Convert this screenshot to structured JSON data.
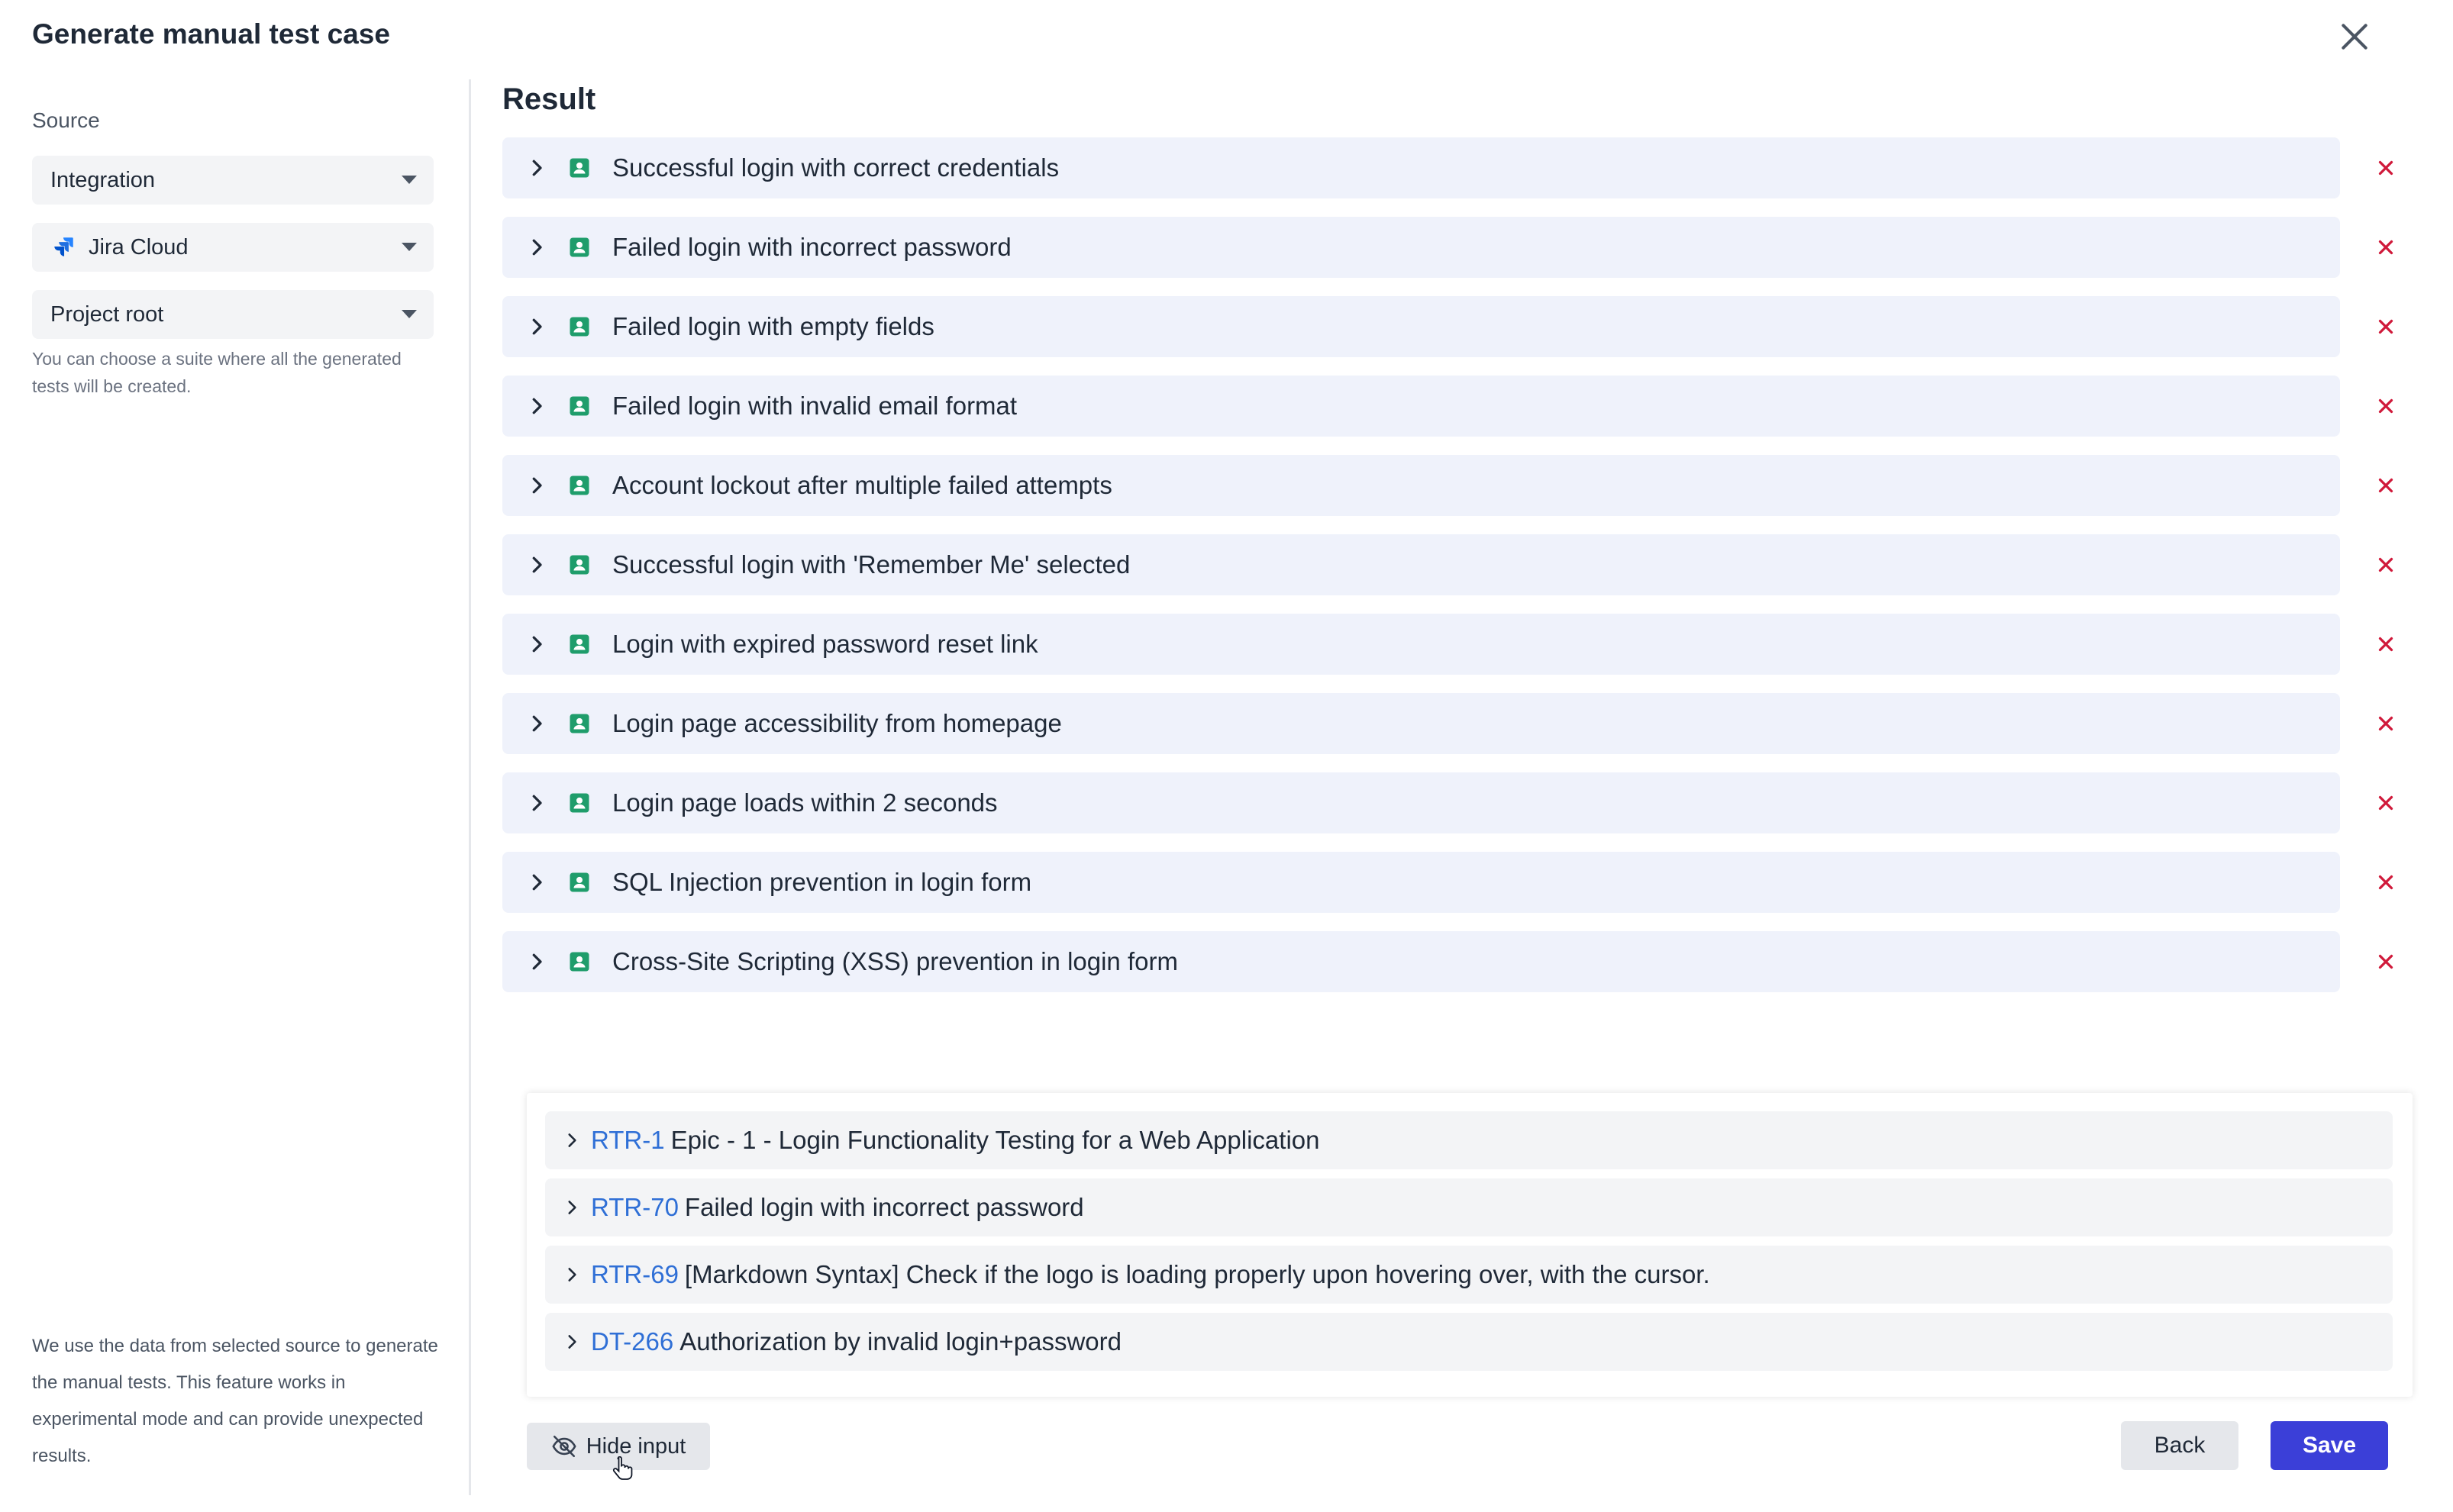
{
  "modal": {
    "title": "Generate manual test case"
  },
  "source": {
    "label": "Source",
    "type_select": "Integration",
    "integration_select": "Jira Cloud",
    "suite_select": "Project root",
    "help_text": "You can choose a suite where all the generated tests will be created.",
    "footer_note": "We use the data from selected source to generate the manual tests. This feature works in experimental mode and can provide unexpected results."
  },
  "result": {
    "title": "Result",
    "items": [
      {
        "label": "Successful login with correct credentials"
      },
      {
        "label": "Failed login with incorrect password"
      },
      {
        "label": "Failed login with empty fields"
      },
      {
        "label": "Failed login with invalid email format"
      },
      {
        "label": "Account lockout after multiple failed attempts"
      },
      {
        "label": "Successful login with 'Remember Me' selected"
      },
      {
        "label": "Login with expired password reset link"
      },
      {
        "label": "Login page accessibility from homepage"
      },
      {
        "label": "Login page loads within 2 seconds"
      },
      {
        "label": "SQL Injection prevention in login form"
      },
      {
        "label": "Cross-Site Scripting (XSS) prevention in login form"
      }
    ]
  },
  "input": {
    "items": [
      {
        "key": "RTR-1",
        "title": "Epic - 1 - Login Functionality Testing for a Web Application"
      },
      {
        "key": "RTR-70",
        "title": "Failed login with incorrect password"
      },
      {
        "key": "RTR-69",
        "title": "[Markdown Syntax] Check if the logo is loading properly upon hovering over, with the cursor."
      },
      {
        "key": "DT-266",
        "title": "Authorization by invalid login+password"
      }
    ]
  },
  "actions": {
    "hide_input": "Hide input",
    "back": "Back",
    "save": "Save"
  },
  "colors": {
    "accent": "#3b3fd8",
    "link": "#2f6fd6",
    "remove": "#d0193a",
    "test_icon": "#1f9d6b",
    "row_bg": "#eff2fb"
  }
}
